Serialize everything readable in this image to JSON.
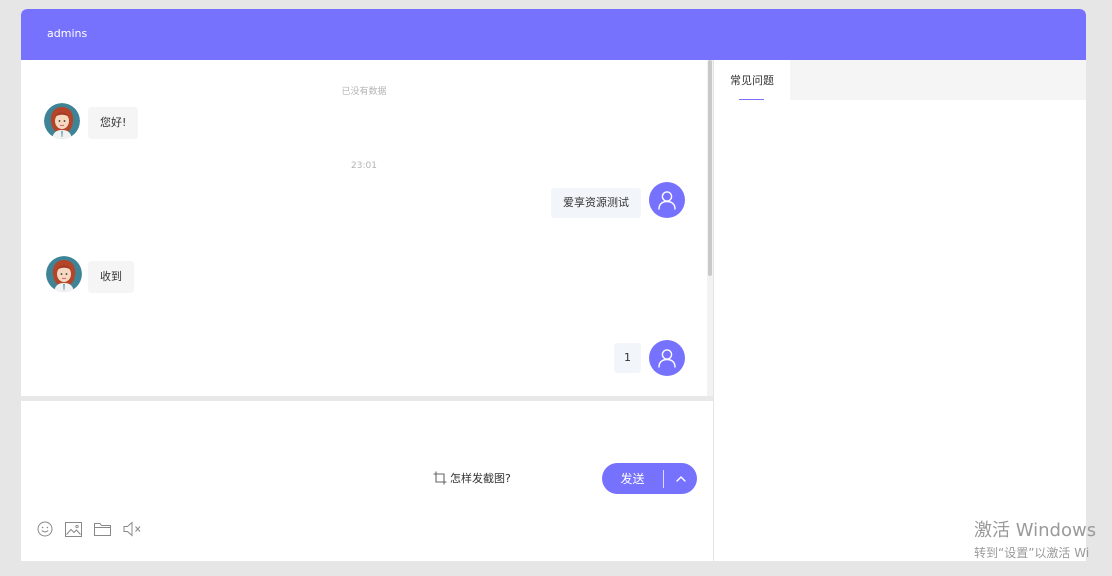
{
  "header": {
    "username": "admins"
  },
  "chat": {
    "no_more": "已没有数据",
    "timestamp": "23:01",
    "messages": [
      {
        "from": "agent",
        "text": "您好!"
      },
      {
        "from": "user",
        "text": "爱享资源测试"
      },
      {
        "from": "agent",
        "text": "收到"
      },
      {
        "from": "user",
        "text": "1"
      }
    ],
    "input_value": ""
  },
  "toolbar": {
    "icons": [
      "emoji-icon",
      "image-icon",
      "folder-icon",
      "mute-icon"
    ],
    "screenshot_help": "怎样发截图?",
    "send_label": "发送"
  },
  "side": {
    "tabs": [
      {
        "label": "常见问题",
        "active": true
      }
    ]
  },
  "watermark": {
    "line1": "激活 Windows",
    "line2": "转到“设置”以激活 Wi"
  },
  "colors": {
    "accent": "#7772fd",
    "bubble_left": "#f5f5f5",
    "bubble_right": "#f2f6fb"
  }
}
